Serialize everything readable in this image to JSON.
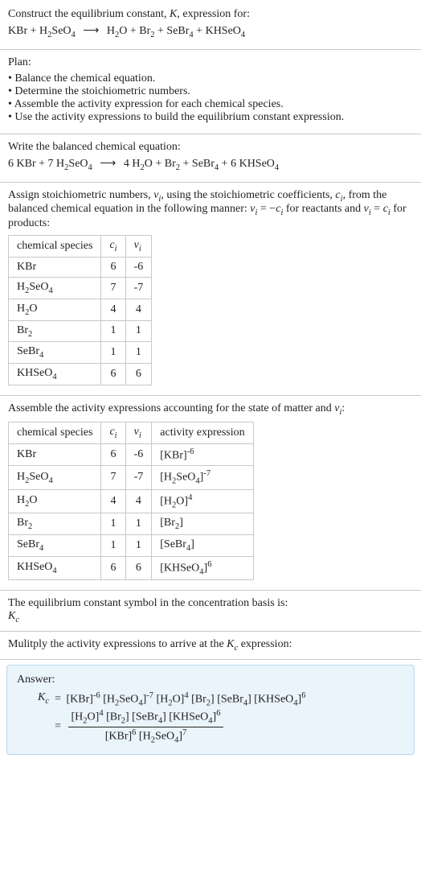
{
  "prompt": {
    "line1a": "Construct the equilibrium constant, ",
    "line1b": ", expression for:"
  },
  "reaction_unbalanced": {
    "r1": {
      "base": "KBr"
    },
    "r2": {
      "base": "H",
      "s1": "2",
      "mid": "SeO",
      "s2": "4"
    },
    "p1": {
      "base": "H",
      "s1": "2",
      "tail": "O"
    },
    "p2": {
      "base": "Br",
      "s1": "2"
    },
    "p3": {
      "base": "SeBr",
      "s1": "4"
    },
    "p4": {
      "base": "KHSeO",
      "s1": "4"
    }
  },
  "plan": {
    "heading": "Plan:",
    "items": [
      "Balance the chemical equation.",
      "Determine the stoichiometric numbers.",
      "Assemble the activity expression for each chemical species.",
      "Use the activity expressions to build the equilibrium constant expression."
    ]
  },
  "balanced": {
    "heading": "Write the balanced chemical equation:",
    "c": {
      "r1": "6",
      "r2": "7",
      "p1": "4",
      "p4": "6"
    }
  },
  "assign": {
    "text_a": "Assign stoichiometric numbers, ",
    "text_b": ", using the stoichiometric coefficients, ",
    "text_c": ", from the balanced chemical equation in the following manner: ",
    "text_d": " for reactants and ",
    "text_e": " for products:"
  },
  "table1": {
    "headers": {
      "h1": "chemical species"
    },
    "rows": [
      {
        "sp": {
          "t": "KBr"
        },
        "c": "6",
        "v": "-6"
      },
      {
        "sp": {
          "a": "H",
          "s1": "2",
          "b": "SeO",
          "s2": "4"
        },
        "c": "7",
        "v": "-7"
      },
      {
        "sp": {
          "a": "H",
          "s1": "2",
          "b": "O"
        },
        "c": "4",
        "v": "4"
      },
      {
        "sp": {
          "a": "Br",
          "s1": "2"
        },
        "c": "1",
        "v": "1"
      },
      {
        "sp": {
          "a": "SeBr",
          "s1": "4"
        },
        "c": "1",
        "v": "1"
      },
      {
        "sp": {
          "a": "KHSeO",
          "s1": "4"
        },
        "c": "6",
        "v": "6"
      }
    ]
  },
  "assemble_text_a": "Assemble the activity expressions accounting for the state of matter and ",
  "assemble_text_b": ":",
  "table2": {
    "headers": {
      "h1": "chemical species",
      "h4": "activity expression"
    },
    "rows": [
      {
        "sp": {
          "t": "KBr"
        },
        "c": "6",
        "v": "-6",
        "ax": {
          "b": "[KBr]",
          "e": "-6"
        }
      },
      {
        "sp": {
          "a": "H",
          "s1": "2",
          "b": "SeO",
          "s2": "4"
        },
        "c": "7",
        "v": "-7",
        "ax": {
          "pre": "[H",
          "s1": "2",
          "mid": "SeO",
          "s2": "4",
          "post": "]",
          "e": "-7"
        }
      },
      {
        "sp": {
          "a": "H",
          "s1": "2",
          "b": "O"
        },
        "c": "4",
        "v": "4",
        "ax": {
          "pre": "[H",
          "s1": "2",
          "mid": "O]",
          "e": "4"
        }
      },
      {
        "sp": {
          "a": "Br",
          "s1": "2"
        },
        "c": "1",
        "v": "1",
        "ax": {
          "pre": "[Br",
          "s1": "2",
          "mid": "]"
        }
      },
      {
        "sp": {
          "a": "SeBr",
          "s1": "4"
        },
        "c": "1",
        "v": "1",
        "ax": {
          "pre": "[SeBr",
          "s1": "4",
          "mid": "]"
        }
      },
      {
        "sp": {
          "a": "KHSeO",
          "s1": "4"
        },
        "c": "6",
        "v": "6",
        "ax": {
          "pre": "[KHSeO",
          "s1": "4",
          "mid": "]",
          "e": "6"
        }
      }
    ]
  },
  "kc_symbol_text": "The equilibrium constant symbol in the concentration basis is:",
  "multiply_text_a": "Mulitply the activity expressions to arrive at the ",
  "multiply_text_b": " expression:",
  "answer_label": "Answer:",
  "symbols": {
    "K": "K",
    "c": "c",
    "nu": "ν",
    "i": "i",
    "ci": "c",
    "eqneg": " = −",
    "eqpos": " = "
  }
}
